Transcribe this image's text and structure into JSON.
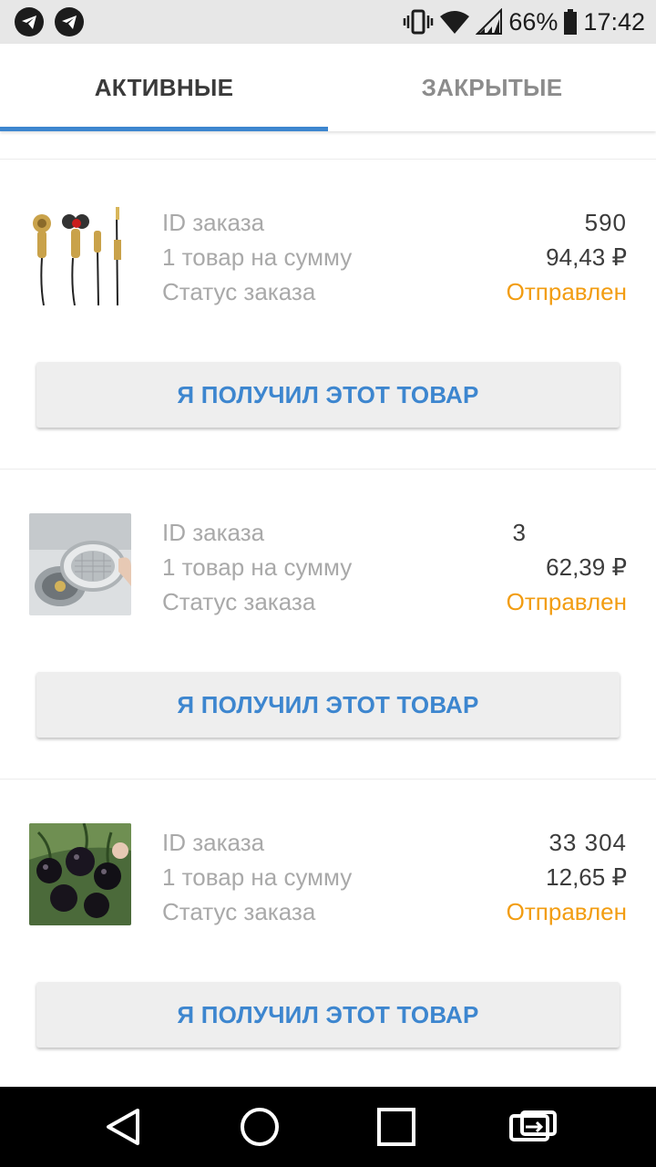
{
  "status_bar": {
    "battery": "66%",
    "time": "17:42"
  },
  "tabs": [
    {
      "label": "АКТИВНЫЕ",
      "active": true
    },
    {
      "label": "ЗАКРЫТЫЕ",
      "active": false
    }
  ],
  "labels": {
    "order_id": "ID заказа",
    "items_sum": "1 товар на сумму",
    "order_status": "Статус заказа"
  },
  "orders": [
    {
      "id_partial": "590",
      "amount": "94,43 ₽",
      "status": "Отправлен",
      "button": "Я ПОЛУЧИЛ ЭТОТ ТОВАР",
      "image": "earphones-image"
    },
    {
      "id_partial": "3",
      "amount": "62,39 ₽",
      "status": "Отправлен",
      "button": "Я ПОЛУЧИЛ ЭТОТ ТОВАР",
      "image": "sink-strainer-image"
    },
    {
      "id_partial": "33 304",
      "amount": "12,65 ₽",
      "status": "Отправлен",
      "button": "Я ПОЛУЧИЛ ЭТОТ ТОВАР",
      "image": "black-tomatoes-image"
    }
  ],
  "colors": {
    "accent": "#3d86cf",
    "status": "#f29d12"
  },
  "nav": [
    "back-icon",
    "home-icon",
    "recents-icon",
    "rotate-icon"
  ]
}
